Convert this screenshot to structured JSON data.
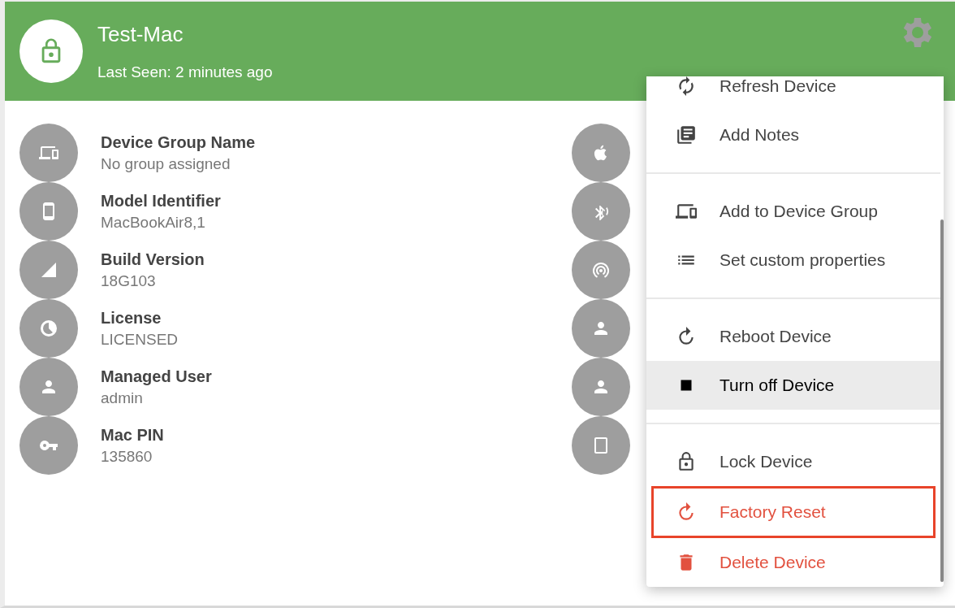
{
  "device": {
    "name": "Test-Mac",
    "last_seen": "Last Seen: 2 minutes ago"
  },
  "details": [
    {
      "label": "Device Group Name",
      "value": "No group assigned"
    },
    {
      "label": "Model Identifier",
      "value": "MacBookAir8,1"
    },
    {
      "label": "Build Version",
      "value": "18G103"
    },
    {
      "label": "License",
      "value": "LICENSED"
    },
    {
      "label": "Managed User",
      "value": "admin"
    },
    {
      "label": "Mac PIN",
      "value": "135860"
    }
  ],
  "menu": {
    "groups": [
      {
        "items": [
          {
            "label": "Refresh Device",
            "kind": "normal",
            "highlighted": false,
            "outlined": false
          },
          {
            "label": "Add Notes",
            "kind": "normal",
            "highlighted": false,
            "outlined": false
          }
        ]
      },
      {
        "items": [
          {
            "label": "Add to Device Group",
            "kind": "normal",
            "highlighted": false,
            "outlined": false
          },
          {
            "label": "Set custom properties",
            "kind": "normal",
            "highlighted": false,
            "outlined": false
          }
        ]
      },
      {
        "items": [
          {
            "label": "Reboot Device",
            "kind": "normal",
            "highlighted": false,
            "outlined": false
          },
          {
            "label": "Turn off Device",
            "kind": "normal",
            "highlighted": true,
            "outlined": false
          }
        ]
      },
      {
        "items": [
          {
            "label": "Lock Device",
            "kind": "normal",
            "highlighted": false,
            "outlined": false
          },
          {
            "label": "Factory Reset",
            "kind": "danger",
            "highlighted": false,
            "outlined": true
          },
          {
            "label": "Delete Device",
            "kind": "danger",
            "highlighted": false,
            "outlined": false
          }
        ]
      }
    ]
  }
}
